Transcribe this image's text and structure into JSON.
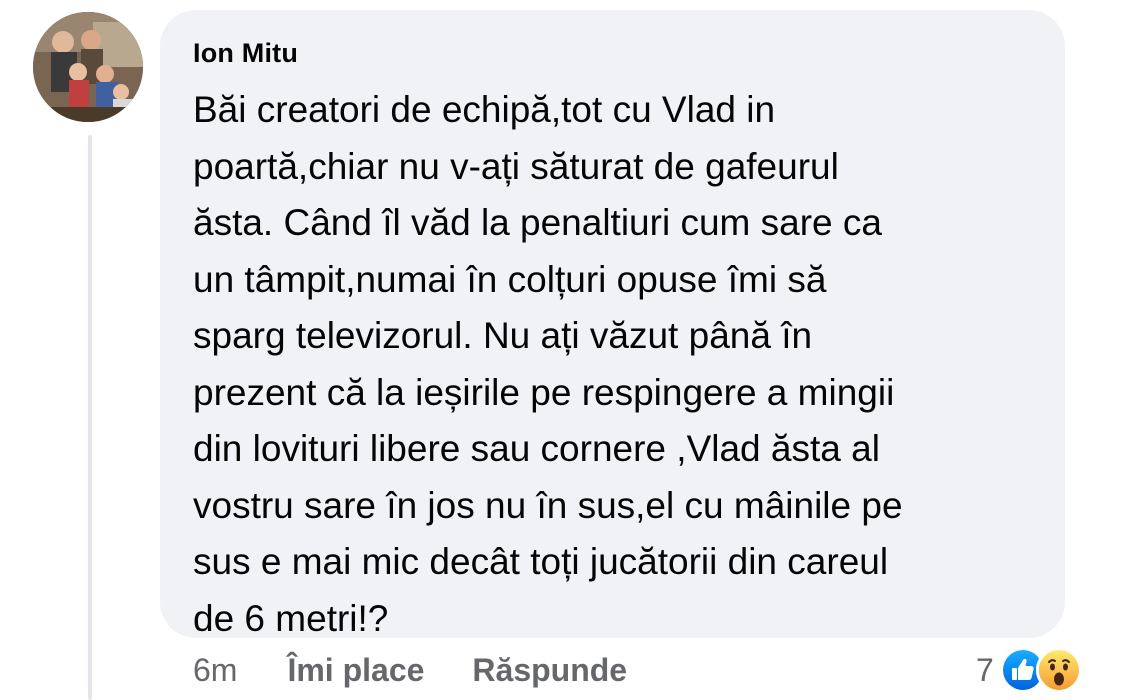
{
  "comment": {
    "author": "Ion Mitu",
    "text_lines": [
      "Băi creatori de echipă,tot cu Vlad in",
      "poartă,chiar nu v-ați săturat de gafeurul",
      "ăsta. Când îl văd la penaltiuri cum sare ca",
      "un tâmpit,numai în colțuri opuse îmi să",
      "sparg televizorul. Nu ați văzut până în",
      "prezent că la ieșirile pe respingere a mingii",
      "din lovituri libere sau cornere ,Vlad ăsta al",
      "vostru sare în jos nu în sus,el cu mâinile pe",
      "sus e mai mic decât toți jucătorii din careul",
      "de 6 metri!?"
    ]
  },
  "actions": {
    "time": "6m",
    "like_label": "Îmi place",
    "reply_label": "Răspunde"
  },
  "reactions": {
    "count": "7",
    "icons": [
      "like-icon",
      "wow-icon"
    ],
    "like_color": "#1877f2",
    "wow_color": "#f7b125"
  }
}
